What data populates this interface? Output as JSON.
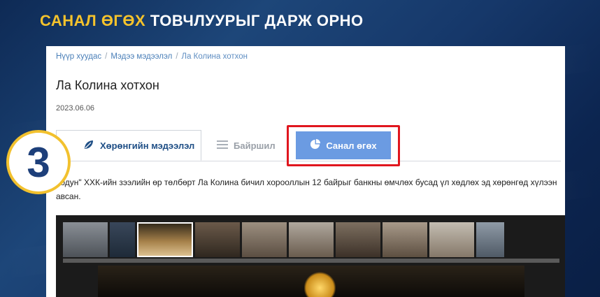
{
  "headline": {
    "accent": "САНАЛ ӨГӨХ",
    "rest": "ТОВЧЛУУРЫГ ДАРЖ ОРНО"
  },
  "breadcrumb": {
    "home": "Нүүр хуудас",
    "news": "Мэдээ мэдээлэл",
    "current": "Ла Колина хотхон"
  },
  "page": {
    "title": "Ла Колина хотхон",
    "date": "2023.06.06"
  },
  "tabs": {
    "general": "Хөрөнгийн мэдээлэл",
    "location": "Байршил",
    "vote": "Санал өгөх"
  },
  "description": "Тодун\" ХХК-ийн зээлийн өр төлбөрт Ла Колина бичил хорооллын 12 байрыг банкны өмчлөх бусад үл хөдлөх эд хөрөнгөд хүлээн авсан.",
  "step": {
    "number": "3"
  },
  "colors": {
    "accent": "#f5c32c",
    "tab_active": "#6b9be2",
    "highlight": "#e0161e",
    "brand": "#1f4f86"
  }
}
